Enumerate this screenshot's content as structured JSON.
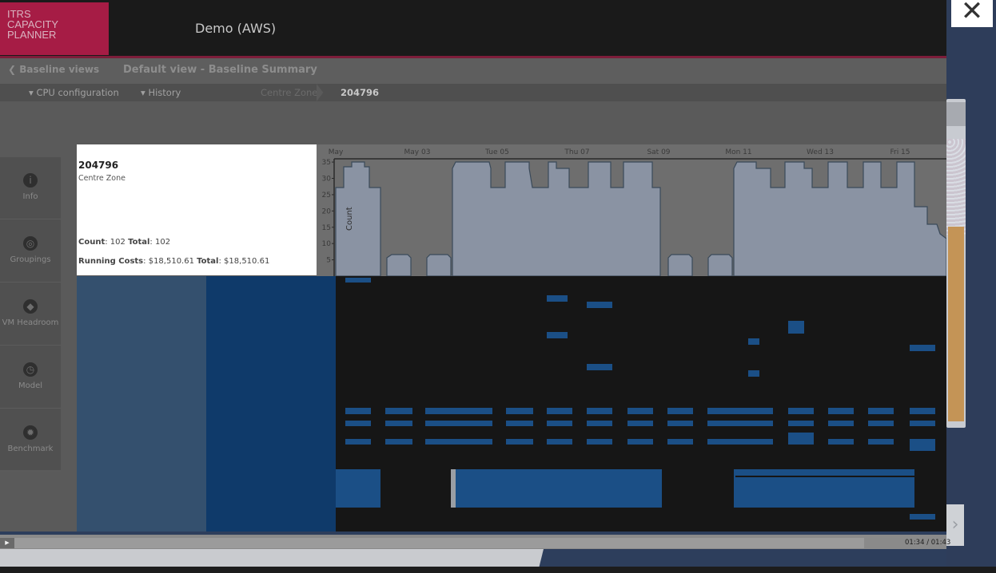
{
  "header": {
    "logo_lines": [
      "ITRS",
      "CAPACITY",
      "PLANNER"
    ],
    "environment": "Demo (AWS)"
  },
  "nav": {
    "back_label": "Baseline views",
    "view_title": "Default view - Baseline Summary"
  },
  "filters": {
    "cpu_config": "CPU configuration",
    "history": "History",
    "breadcrumb_zone": "Centre Zone",
    "breadcrumb_id": "204796"
  },
  "tools": [
    {
      "label": "Info",
      "icon": "info-icon",
      "glyph": "i"
    },
    {
      "label": "Groupings",
      "icon": "target-icon",
      "glyph": "◎"
    },
    {
      "label": "VM Headroom",
      "icon": "layers-icon",
      "glyph": "◆"
    },
    {
      "label": "Model",
      "icon": "clock-icon",
      "glyph": "◷"
    },
    {
      "label": "Benchmark",
      "icon": "gear-icon",
      "glyph": "✹"
    }
  ],
  "card": {
    "id": "204796",
    "zone": "Centre Zone",
    "count_label": "Count",
    "count_value": "102",
    "count_total_label": "Total",
    "count_total": "102",
    "cost_label": "Running Costs",
    "cost_value": "$18,510.61",
    "cost_total_label": "Total",
    "cost_total": "$18,510.61"
  },
  "chart_data": {
    "type": "area",
    "x_ticks": [
      "May",
      "May 03",
      "Tue 05",
      "Thu 07",
      "Sat 09",
      "Mon 11",
      "Wed 13",
      "Fri 15"
    ],
    "ylabel": "Count",
    "y_ticks": [
      5,
      10,
      15,
      20,
      25,
      30,
      35
    ],
    "ylim": [
      0,
      36
    ]
  },
  "player": {
    "play_glyph": "▶",
    "time": "01:34 / 01:43",
    "progress": 0.913
  },
  "close_glyph": "✕",
  "next_glyph": "›"
}
